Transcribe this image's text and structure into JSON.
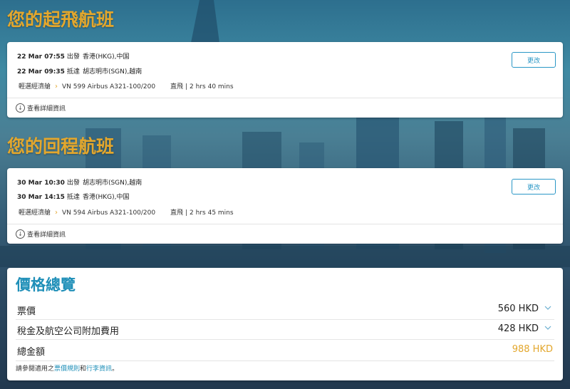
{
  "outbound": {
    "title": "您的起飛航班",
    "depart": {
      "datetime": "22 Mar 07:55",
      "label": "出發",
      "place": "香港(HKG),中国"
    },
    "arrive": {
      "datetime": "22 Mar 09:35",
      "label": "抵達",
      "place": "胡志明市(SGN),越南"
    },
    "fare_class": "輕選經濟艙",
    "flight": "VN 599 Airbus A321-100/200",
    "stops": "直飛",
    "separator": "|",
    "duration": "2 hrs 40 mins",
    "change_label": "更改",
    "details_label": "查看詳細資訊"
  },
  "return": {
    "title": "您的回程航班",
    "depart": {
      "datetime": "30 Mar 10:30",
      "label": "出發",
      "place": "胡志明市(SGN),越南"
    },
    "arrive": {
      "datetime": "30 Mar 14:15",
      "label": "抵達",
      "place": "香港(HKG),中国"
    },
    "fare_class": "輕選經濟艙",
    "flight": "VN 594 Airbus A321-100/200",
    "stops": "直飛",
    "separator": "|",
    "duration": "2 hrs 45 mins",
    "change_label": "更改",
    "details_label": "查看詳細資訊"
  },
  "price": {
    "title": "價格總覽",
    "fare": {
      "label": "票價",
      "amount": "560 HKD"
    },
    "taxes": {
      "label": "稅金及航空公司附加費用",
      "amount": "428 HKD"
    },
    "total": {
      "label": "總金額",
      "amount": "988 HKD"
    },
    "note_prefix": "請參閱適用之",
    "fare_rules_link": "票價規則",
    "note_and": "和",
    "baggage_link": "行李資訊",
    "note_suffix": "。"
  },
  "colors": {
    "accent_gold": "#e3a72d",
    "link_blue": "#1f8fb8"
  }
}
